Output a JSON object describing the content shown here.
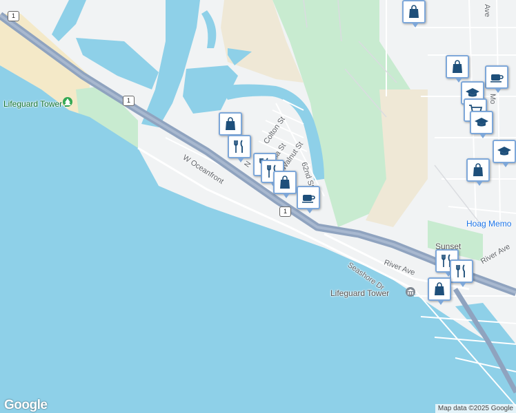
{
  "map": {
    "colors": {
      "water": "#8ed0e8",
      "land": "#f1f3f4",
      "beach": "#f4e9c8",
      "park": "#c8ebd0",
      "highway": "#8fa3bf",
      "marker_border": "#7da7d9",
      "marker_icon": "#1e4f7a"
    },
    "street_labels": [
      "W Oceanfront",
      "Seashore Dr",
      "River Ave",
      "River Ave",
      "Colton St",
      "Nia St",
      "Walnut St",
      "62nd St",
      "N",
      "Mo",
      "Ave"
    ],
    "highway_shield": "1",
    "place_labels": {
      "lifeguard_tower_2": "Lifeguard Tower 2",
      "lifeguard_tower": "Lifeguard Tower",
      "hoag": "Hoag Memo",
      "sunset": "Sunset"
    },
    "markers": [
      {
        "icon": "shopping-bag-icon",
        "category": "Shopping"
      },
      {
        "icon": "shopping-bag-icon",
        "category": "Shopping"
      },
      {
        "icon": "coffee-icon",
        "category": "Cafe"
      },
      {
        "icon": "graduation-cap-icon",
        "category": "School"
      },
      {
        "icon": "shopping-cart-icon",
        "category": "Grocery"
      },
      {
        "icon": "graduation-cap-icon",
        "category": "School"
      },
      {
        "icon": "graduation-cap-icon",
        "category": "School"
      },
      {
        "icon": "shopping-bag-icon",
        "category": "Shopping"
      },
      {
        "icon": "shopping-bag-icon",
        "category": "Shopping"
      },
      {
        "icon": "restaurant-icon",
        "category": "Restaurant"
      },
      {
        "icon": "restaurant-icon",
        "category": "Restaurant"
      },
      {
        "icon": "restaurant-icon",
        "category": "Restaurant"
      },
      {
        "icon": "shopping-bag-icon",
        "category": "Shopping"
      },
      {
        "icon": "coffee-icon",
        "category": "Cafe"
      },
      {
        "icon": "restaurant-icon",
        "category": "Restaurant"
      },
      {
        "icon": "restaurant-icon",
        "category": "Restaurant"
      },
      {
        "icon": "shopping-bag-icon",
        "category": "Shopping"
      }
    ],
    "logo": "Google",
    "attribution": "Map data ©2025 Google"
  }
}
